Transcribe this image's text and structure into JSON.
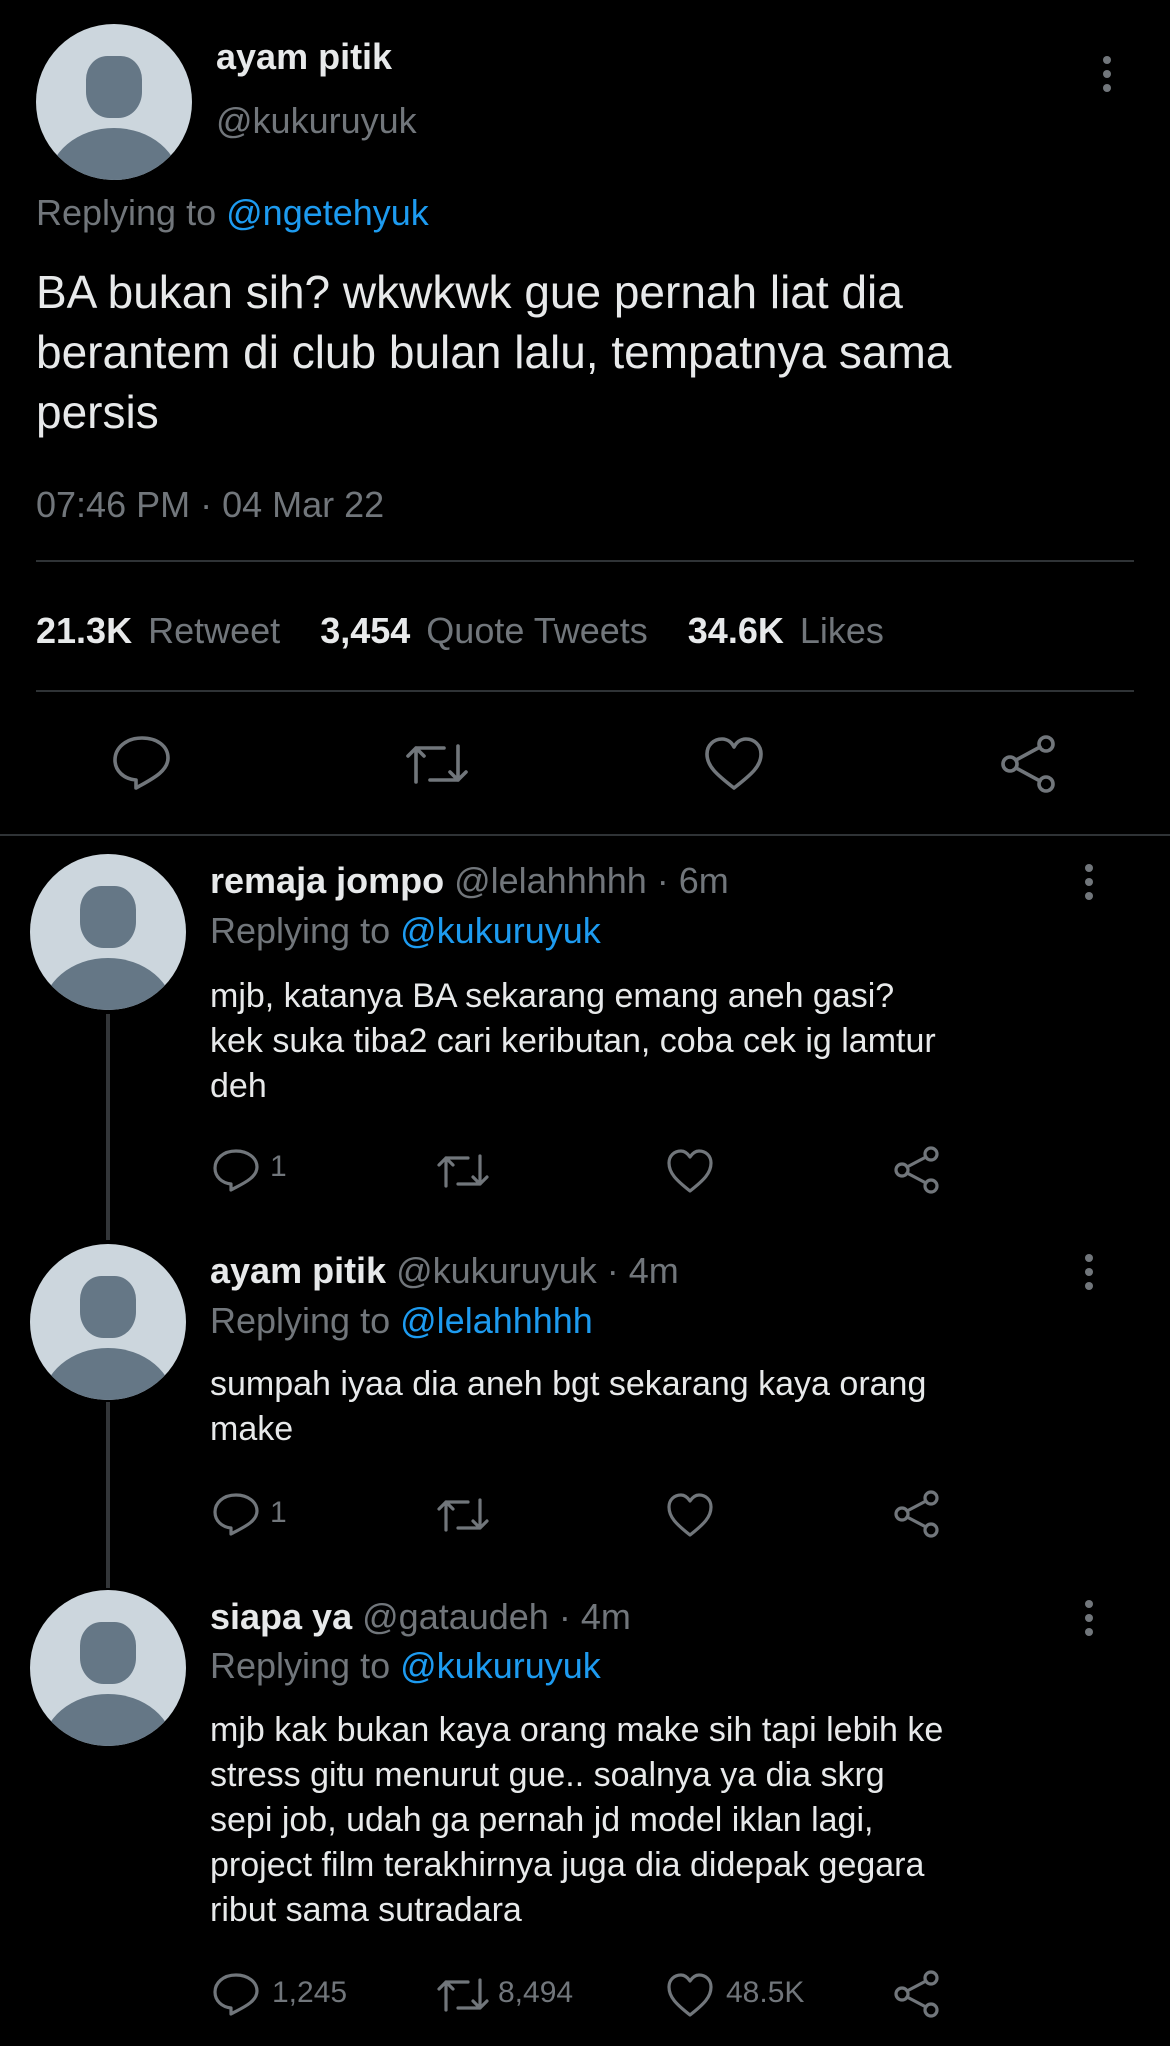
{
  "main_tweet": {
    "display_name": "ayam pitik",
    "handle": "@kukuruyuk",
    "replying_prefix": "Replying to",
    "replying_to": "@ngetehyuk",
    "text_lines": [
      "BA bukan sih? wkwkwk gue pernah liat dia",
      "berantem di club bulan lalu, tempatnya sama",
      "persis"
    ],
    "timestamp": "07:46 PM · 04 Mar 22",
    "stats": {
      "retweets_value": "21.3K",
      "retweets_label": "Retweet",
      "quotes_value": "3,454",
      "quotes_label": "Quote Tweets",
      "likes_value": "34.6K",
      "likes_label": "Likes"
    },
    "actions": [
      "reply-icon",
      "retweet-icon",
      "like-icon",
      "share-icon"
    ]
  },
  "replies": [
    {
      "display_name": "remaja jompo",
      "meta": "@lelahhhhh · 6m",
      "replying_prefix": "Replying to",
      "replying_to": "@kukuruyuk",
      "text_lines": [
        "mjb, katanya BA sekarang emang aneh gasi?",
        "kek suka tiba2 cari keributan, coba cek ig lamtur",
        "deh"
      ],
      "reply_count": "1",
      "retweet_count": "",
      "like_count": ""
    },
    {
      "display_name": "ayam pitik",
      "meta": "@kukuruyuk · 4m",
      "replying_prefix": "Replying to",
      "replying_to": "@lelahhhhh",
      "text_lines": [
        "sumpah iyaa dia aneh bgt sekarang kaya orang",
        "make"
      ],
      "reply_count": "1",
      "retweet_count": "",
      "like_count": ""
    },
    {
      "display_name": "siapa ya",
      "meta": "@gataudeh · 4m",
      "replying_prefix": "Replying to",
      "replying_to": "@kukuruyuk",
      "text_lines": [
        "mjb kak bukan kaya orang make sih tapi lebih ke",
        "stress gitu menurut gue.. soalnya ya dia skrg",
        "sepi job, udah ga pernah jd model iklan lagi,",
        "project film terakhirnya juga dia didepak gegara",
        "ribut sama sutradara"
      ],
      "reply_count": "1,245",
      "retweet_count": "8,494",
      "like_count": "48.5K"
    }
  ],
  "colors": {
    "background": "#000000",
    "text": "#e7e9ea",
    "muted": "#71767b",
    "link": "#1d9bf0",
    "divider": "#2f3336"
  }
}
